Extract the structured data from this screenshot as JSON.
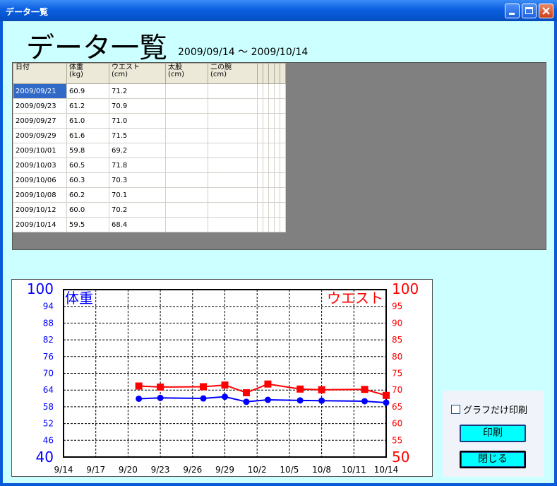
{
  "window": {
    "title": "データ一覧"
  },
  "heading": "データ一覧",
  "date_range": "2009/09/14 ～ 2009/10/14",
  "table": {
    "headers": [
      {
        "line1": "日付",
        "line2": ""
      },
      {
        "line1": "体重",
        "line2": "(kg)"
      },
      {
        "line1": "ウエスト",
        "line2": "(cm)"
      },
      {
        "line1": "太股",
        "line2": "(cm)"
      },
      {
        "line1": "二の腕",
        "line2": "(cm)"
      }
    ],
    "rows": [
      [
        "2009/09/21",
        "60.9",
        "71.2",
        "",
        ""
      ],
      [
        "2009/09/23",
        "61.2",
        "70.9",
        "",
        ""
      ],
      [
        "2009/09/27",
        "61.0",
        "71.0",
        "",
        ""
      ],
      [
        "2009/09/29",
        "61.6",
        "71.5",
        "",
        ""
      ],
      [
        "2009/10/01",
        "59.8",
        "69.2",
        "",
        ""
      ],
      [
        "2009/10/03",
        "60.5",
        "71.8",
        "",
        ""
      ],
      [
        "2009/10/06",
        "60.3",
        "70.3",
        "",
        ""
      ],
      [
        "2009/10/08",
        "60.2",
        "70.1",
        "",
        ""
      ],
      [
        "2009/10/12",
        "60.0",
        "70.2",
        "",
        ""
      ],
      [
        "2009/10/14",
        "59.5",
        "68.4",
        "",
        ""
      ]
    ]
  },
  "chart_data": {
    "type": "line",
    "title": "",
    "left_axis_label": "体重",
    "right_axis_label": "ウエスト",
    "left_ylim": [
      40,
      100
    ],
    "right_ylim": [
      50,
      100
    ],
    "left_ticks": [
      "100",
      "94",
      "88",
      "82",
      "76",
      "70",
      "64",
      "58",
      "52",
      "46",
      "40"
    ],
    "right_ticks": [
      "100",
      "95",
      "90",
      "85",
      "80",
      "75",
      "70",
      "65",
      "60",
      "55",
      "50"
    ],
    "x_tick_labels": [
      "9/14",
      "9/17",
      "9/20",
      "9/23",
      "9/26",
      "9/29",
      "10/2",
      "10/5",
      "10/8",
      "10/11",
      "10/14"
    ],
    "x_range_days": [
      0,
      30
    ],
    "grid": true,
    "left_color": "#0000ff",
    "right_color": "#ff0000",
    "series": [
      {
        "axis": "left",
        "marker": "circle",
        "color": "#0000ff",
        "x": [
          "9/21",
          "9/23",
          "9/27",
          "9/29",
          "10/1",
          "10/3",
          "10/6",
          "10/8",
          "10/12",
          "10/14"
        ],
        "values": [
          60.9,
          61.2,
          61.0,
          61.6,
          59.8,
          60.5,
          60.3,
          60.2,
          60.0,
          59.5
        ]
      },
      {
        "axis": "right",
        "marker": "square",
        "color": "#ff0000",
        "x": [
          "9/21",
          "9/23",
          "9/27",
          "9/29",
          "10/1",
          "10/3",
          "10/6",
          "10/8",
          "10/12",
          "10/14"
        ],
        "values": [
          71.2,
          70.9,
          71.0,
          71.5,
          69.2,
          71.8,
          70.3,
          70.1,
          70.2,
          68.4
        ]
      }
    ]
  },
  "controls": {
    "graph_only_print_label": "グラフだけ印刷",
    "graph_only_print_checked": false,
    "print_label": "印刷",
    "close_label": "閉じる"
  }
}
